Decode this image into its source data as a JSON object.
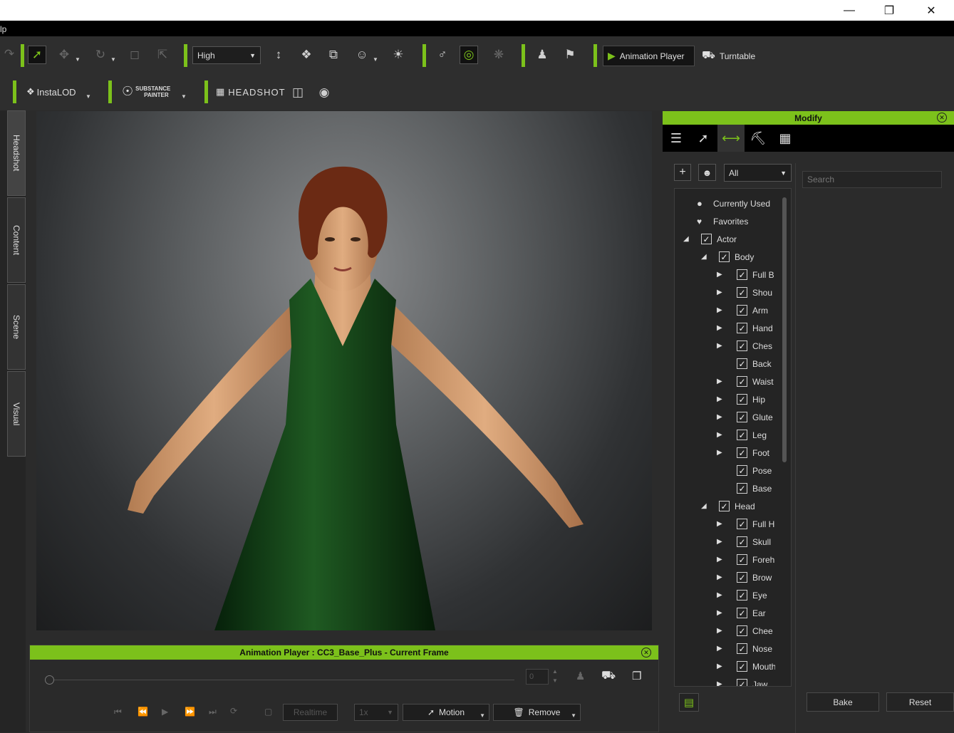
{
  "menubar": {
    "fragment": "lp"
  },
  "toolbar1": {
    "quality_value": "High",
    "animation_player_label": "Animation Player",
    "turntable_label": "Turntable"
  },
  "toolbar2": {
    "instalod_label": "InstaLOD",
    "substance_line1": "SUBSTANCE",
    "substance_line2": "PAINTER",
    "headshot_label": "HEADSHOT"
  },
  "left_tabs": [
    "Headshot",
    "Content",
    "Scene",
    "Visual"
  ],
  "animation_player": {
    "title": "Animation Player : CC3_Base_Plus - Current Frame",
    "frame_value": "0",
    "realtime_label": "Realtime",
    "speed_value": "1x",
    "motion_label": "Motion",
    "remove_label": "Remove"
  },
  "modify": {
    "title": "Modify",
    "filter_value": "All",
    "search_placeholder": "Search",
    "bake_label": "Bake",
    "reset_label": "Reset",
    "tree": [
      {
        "label": "Currently Used",
        "level": 0,
        "kind": "dot"
      },
      {
        "label": "Favorites",
        "level": 0,
        "kind": "heart"
      },
      {
        "label": "Actor",
        "level": 0,
        "kind": "expanded"
      },
      {
        "label": "Body",
        "level": 1,
        "kind": "expanded"
      },
      {
        "label": "Full B",
        "level": 2,
        "kind": "collapsed"
      },
      {
        "label": "Shou",
        "level": 2,
        "kind": "collapsed"
      },
      {
        "label": "Arm",
        "level": 2,
        "kind": "collapsed"
      },
      {
        "label": "Hand",
        "level": 2,
        "kind": "collapsed"
      },
      {
        "label": "Ches",
        "level": 2,
        "kind": "collapsed"
      },
      {
        "label": "Back",
        "level": 2,
        "kind": "leaf"
      },
      {
        "label": "Waist",
        "level": 2,
        "kind": "collapsed"
      },
      {
        "label": "Hip",
        "level": 2,
        "kind": "collapsed"
      },
      {
        "label": "Glute",
        "level": 2,
        "kind": "collapsed"
      },
      {
        "label": "Leg",
        "level": 2,
        "kind": "collapsed"
      },
      {
        "label": "Foot",
        "level": 2,
        "kind": "collapsed"
      },
      {
        "label": "Pose",
        "level": 2,
        "kind": "leaf"
      },
      {
        "label": "Base",
        "level": 2,
        "kind": "leaf"
      },
      {
        "label": "Head",
        "level": 1,
        "kind": "expanded"
      },
      {
        "label": "Full H",
        "level": 2,
        "kind": "collapsed"
      },
      {
        "label": "Skull",
        "level": 2,
        "kind": "collapsed"
      },
      {
        "label": "Foreh",
        "level": 2,
        "kind": "collapsed"
      },
      {
        "label": "Brow",
        "level": 2,
        "kind": "collapsed"
      },
      {
        "label": "Eye",
        "level": 2,
        "kind": "collapsed"
      },
      {
        "label": "Ear",
        "level": 2,
        "kind": "collapsed"
      },
      {
        "label": "Chee",
        "level": 2,
        "kind": "collapsed"
      },
      {
        "label": "Nose",
        "level": 2,
        "kind": "collapsed"
      },
      {
        "label": "Mouth",
        "level": 2,
        "kind": "collapsed"
      },
      {
        "label": "Jaw",
        "level": 2,
        "kind": "collapsed"
      }
    ]
  },
  "colors": {
    "accent": "#7cc11b",
    "dress": "#0f3a12",
    "skin": "#d9a274",
    "hair": "#6b2a14"
  }
}
